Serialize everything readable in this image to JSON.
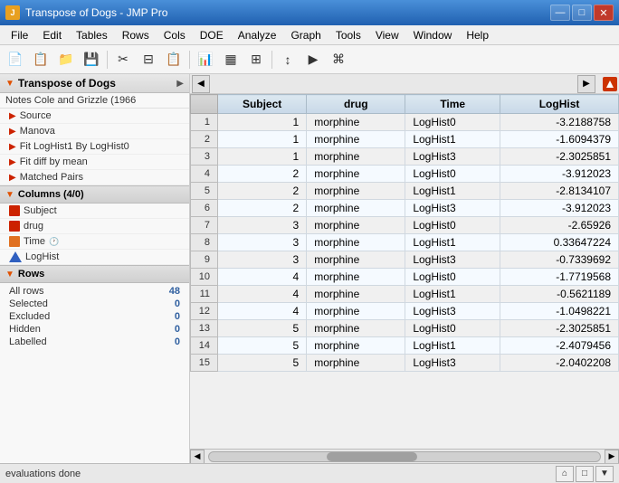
{
  "titleBar": {
    "icon": "J",
    "title": "Transpose of Dogs - JMP Pro",
    "minimizeLabel": "—",
    "maximizeLabel": "□",
    "closeLabel": "✕"
  },
  "menuBar": {
    "items": [
      "File",
      "Edit",
      "Tables",
      "Rows",
      "Cols",
      "DOE",
      "Analyze",
      "Graph",
      "Tools",
      "View",
      "Window",
      "Help"
    ]
  },
  "toolbar": {
    "buttons": [
      "📄",
      "📋",
      "📁",
      "💾",
      "✂",
      "📑",
      "📋",
      "",
      "📊",
      "▦",
      "⊞",
      "",
      "↕",
      "▶",
      ""
    ]
  },
  "leftPanel": {
    "header": "Transpose of Dogs",
    "notes": "Notes  Cole and Grizzle (1966",
    "sections": [
      {
        "label": "Source"
      },
      {
        "label": "Manova"
      },
      {
        "label": "Fit LogHist1 By LogHist0"
      },
      {
        "label": "Fit diff by mean"
      },
      {
        "label": "Matched Pairs"
      }
    ],
    "columnsHeader": "Columns (4/0)",
    "columns": [
      {
        "name": "Subject",
        "type": "red"
      },
      {
        "name": "drug",
        "type": "red"
      },
      {
        "name": "Time",
        "type": "orange"
      },
      {
        "name": "LogHist",
        "type": "blue"
      }
    ],
    "rowsHeader": "Rows",
    "rowStats": [
      {
        "label": "All rows",
        "value": "48"
      },
      {
        "label": "Selected",
        "value": "0"
      },
      {
        "label": "Excluded",
        "value": "0"
      },
      {
        "label": "Hidden",
        "value": "0"
      },
      {
        "label": "Labelled",
        "value": "0"
      }
    ]
  },
  "table": {
    "columns": [
      "Subject",
      "drug",
      "Time",
      "LogHist"
    ],
    "rows": [
      {
        "rowNum": 1,
        "Subject": 1,
        "drug": "morphine",
        "Time": "LogHist0",
        "LogHist": -3.2188758
      },
      {
        "rowNum": 2,
        "Subject": 1,
        "drug": "morphine",
        "Time": "LogHist1",
        "LogHist": -1.6094379
      },
      {
        "rowNum": 3,
        "Subject": 1,
        "drug": "morphine",
        "Time": "LogHist3",
        "LogHist": -2.3025851
      },
      {
        "rowNum": 4,
        "Subject": 2,
        "drug": "morphine",
        "Time": "LogHist0",
        "LogHist": -3.912023
      },
      {
        "rowNum": 5,
        "Subject": 2,
        "drug": "morphine",
        "Time": "LogHist1",
        "LogHist": -2.8134107
      },
      {
        "rowNum": 6,
        "Subject": 2,
        "drug": "morphine",
        "Time": "LogHist3",
        "LogHist": -3.912023
      },
      {
        "rowNum": 7,
        "Subject": 3,
        "drug": "morphine",
        "Time": "LogHist0",
        "LogHist": -2.65926
      },
      {
        "rowNum": 8,
        "Subject": 3,
        "drug": "morphine",
        "Time": "LogHist1",
        "LogHist": 0.33647224
      },
      {
        "rowNum": 9,
        "Subject": 3,
        "drug": "morphine",
        "Time": "LogHist3",
        "LogHist": -0.7339692
      },
      {
        "rowNum": 10,
        "Subject": 4,
        "drug": "morphine",
        "Time": "LogHist0",
        "LogHist": -1.7719568
      },
      {
        "rowNum": 11,
        "Subject": 4,
        "drug": "morphine",
        "Time": "LogHist1",
        "LogHist": -0.5621189
      },
      {
        "rowNum": 12,
        "Subject": 4,
        "drug": "morphine",
        "Time": "LogHist3",
        "LogHist": -1.0498221
      },
      {
        "rowNum": 13,
        "Subject": 5,
        "drug": "morphine",
        "Time": "LogHist0",
        "LogHist": -2.3025851
      },
      {
        "rowNum": 14,
        "Subject": 5,
        "drug": "morphine",
        "Time": "LogHist1",
        "LogHist": -2.4079456
      },
      {
        "rowNum": 15,
        "Subject": 5,
        "drug": "morphine",
        "Time": "LogHist3",
        "LogHist": -2.0402208
      }
    ]
  },
  "statusBar": {
    "text": "evaluations done"
  }
}
